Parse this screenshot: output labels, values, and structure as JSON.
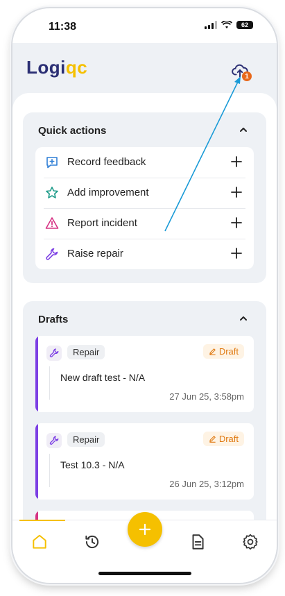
{
  "status_bar": {
    "time": "11:38",
    "battery": "62"
  },
  "header": {
    "logo_part1": "Logi",
    "logo_part2": "qc",
    "sync_badge_count": "1",
    "sync_icon": "cloud-upload-icon"
  },
  "quick_actions": {
    "title": "Quick actions",
    "items": [
      {
        "label": "Record feedback",
        "icon": "feedback-icon",
        "color": "#2f7fd6"
      },
      {
        "label": "Add improvement",
        "icon": "star-icon",
        "color": "#1f9c8a"
      },
      {
        "label": "Report incident",
        "icon": "warning-icon",
        "color": "#d63384"
      },
      {
        "label": "Raise repair",
        "icon": "wrench-icon",
        "color": "#7c3fe4"
      }
    ]
  },
  "drafts": {
    "title": "Drafts",
    "items": [
      {
        "type": "Repair",
        "status": "Draft",
        "title": "New draft test - N/A",
        "date": "27 Jun 25, 3:58pm"
      },
      {
        "type": "Repair",
        "status": "Draft",
        "title": "Test 10.3 - N/A",
        "date": "26 Jun 25, 3:12pm"
      }
    ]
  },
  "tab_bar": {
    "tabs": [
      "home-icon",
      "history-icon",
      "add-icon",
      "document-icon",
      "settings-icon"
    ],
    "accent": "#f5c000"
  },
  "colors": {
    "brand_navy": "#2b2f74",
    "brand_yellow": "#f5c000",
    "draft_orange": "#e07a12",
    "annotation_arrow": "#1a9bd7"
  }
}
